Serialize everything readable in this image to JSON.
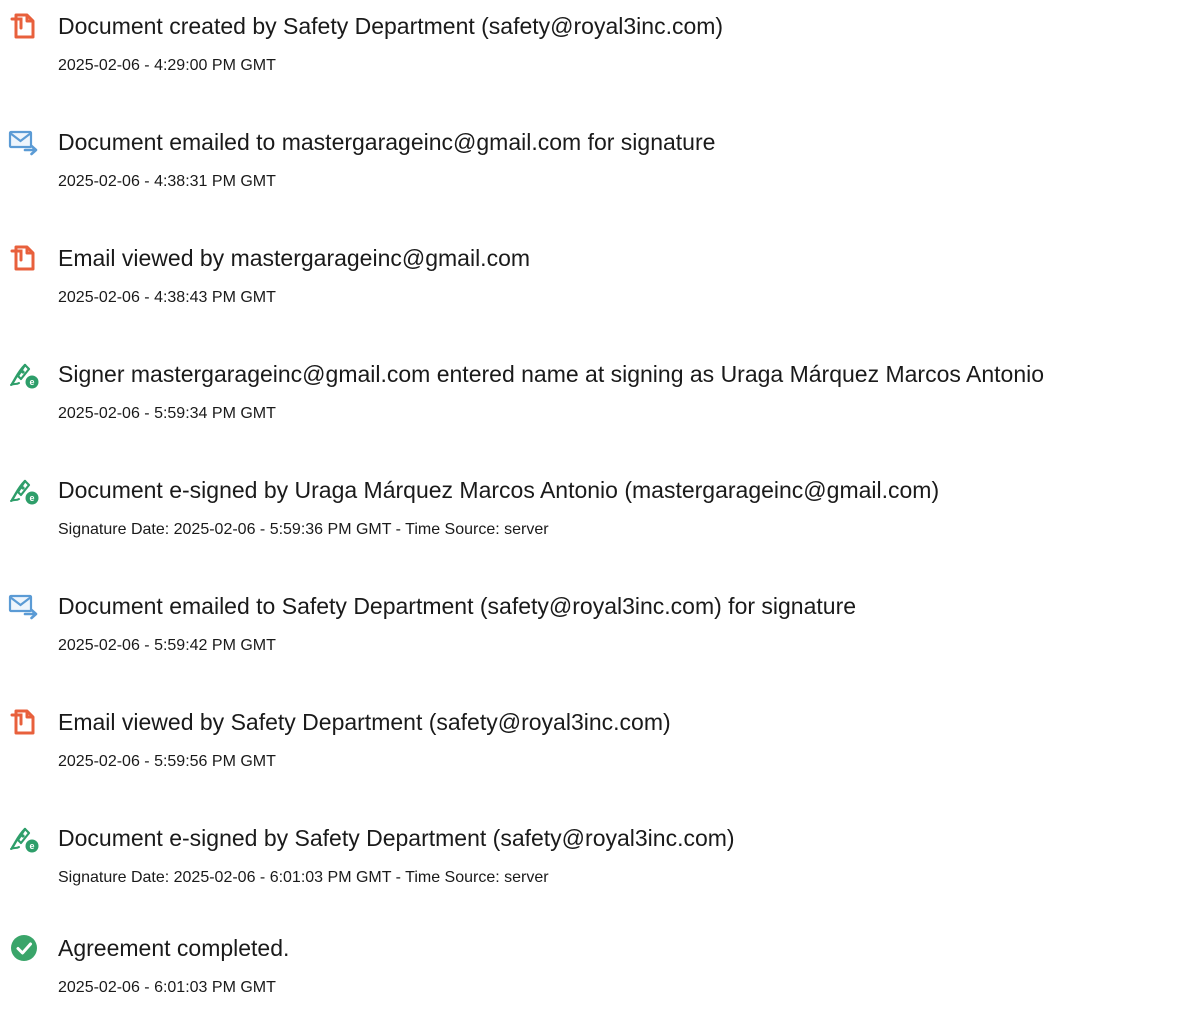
{
  "events": [
    {
      "icon": "document-created-icon",
      "title": "Document created by Safety Department (safety@royal3inc.com)",
      "subtitle": "2025-02-06 - 4:29:00 PM GMT"
    },
    {
      "icon": "document-emailed-icon",
      "title": "Document emailed to mastergarageinc@gmail.com for signature",
      "subtitle": "2025-02-06 - 4:38:31 PM GMT"
    },
    {
      "icon": "email-viewed-icon",
      "title": "Email viewed by mastergarageinc@gmail.com",
      "subtitle": "2025-02-06 - 4:38:43 PM GMT"
    },
    {
      "icon": "e-signature-icon",
      "title": "Signer mastergarageinc@gmail.com entered name at signing as Uraga Márquez Marcos Antonio",
      "subtitle": "2025-02-06 - 5:59:34 PM GMT"
    },
    {
      "icon": "e-signature-icon",
      "title": "Document e-signed by Uraga Márquez Marcos Antonio (mastergarageinc@gmail.com)",
      "subtitle": "Signature Date: 2025-02-06 - 5:59:36 PM GMT - Time Source: server"
    },
    {
      "icon": "document-emailed-icon",
      "title": "Document emailed to Safety Department (safety@royal3inc.com) for signature",
      "subtitle": "2025-02-06 - 5:59:42 PM GMT"
    },
    {
      "icon": "email-viewed-icon",
      "title": "Email viewed by Safety Department (safety@royal3inc.com)",
      "subtitle": "2025-02-06 - 5:59:56 PM GMT"
    },
    {
      "icon": "e-signature-icon",
      "title": "Document e-signed by Safety Department (safety@royal3inc.com)",
      "subtitle": "Signature Date: 2025-02-06 - 6:01:03 PM GMT - Time Source: server"
    },
    {
      "icon": "agreement-completed-icon",
      "title": "Agreement completed.",
      "subtitle": "2025-02-06 - 6:01:03 PM GMT"
    }
  ],
  "colors": {
    "document_orange": "#e8603c",
    "email_blue": "#5b9bd5",
    "sign_green": "#2e9e6a",
    "complete_green": "#3aa56a"
  }
}
